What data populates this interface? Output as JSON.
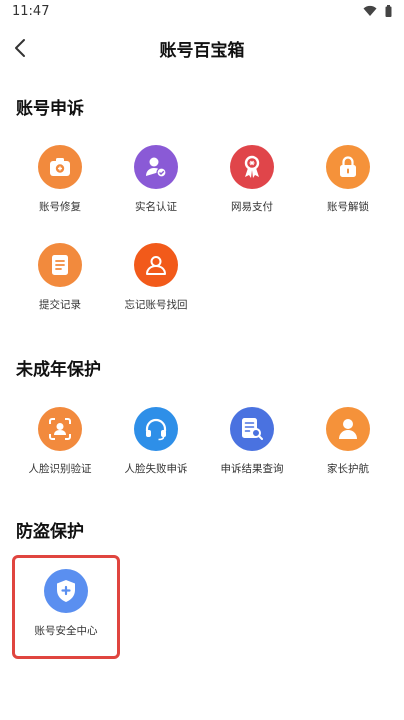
{
  "status": {
    "time": "11:47"
  },
  "header": {
    "title": "账号百宝箱"
  },
  "sections": [
    {
      "title": "账号申诉",
      "items": [
        {
          "label": "账号修复",
          "icon": "camera-icon",
          "color": "#f28a3d"
        },
        {
          "label": "实名认证",
          "icon": "user-verify-icon",
          "color": "#8a5ad6"
        },
        {
          "label": "网易支付",
          "icon": "ribbon-icon",
          "color": "#e0454a"
        },
        {
          "label": "账号解锁",
          "icon": "lock-icon",
          "color": "#f5923a"
        },
        {
          "label": "提交记录",
          "icon": "document-icon",
          "color": "#f28a3d"
        },
        {
          "label": "忘记账号找回",
          "icon": "user-search-icon",
          "color": "#f25a1a"
        }
      ]
    },
    {
      "title": "未成年保护",
      "items": [
        {
          "label": "人脸识别验证",
          "icon": "face-scan-icon",
          "color": "#f28a3d"
        },
        {
          "label": "人脸失败申诉",
          "icon": "headset-icon",
          "color": "#2e8fe8"
        },
        {
          "label": "申诉结果查询",
          "icon": "document-search-icon",
          "color": "#4a72e0"
        },
        {
          "label": "家长护航",
          "icon": "person-icon",
          "color": "#f5923a"
        }
      ]
    },
    {
      "title": "防盗保护",
      "items": [
        {
          "label": "账号安全中心",
          "icon": "shield-icon",
          "color": "#5a8ff0"
        }
      ]
    }
  ]
}
